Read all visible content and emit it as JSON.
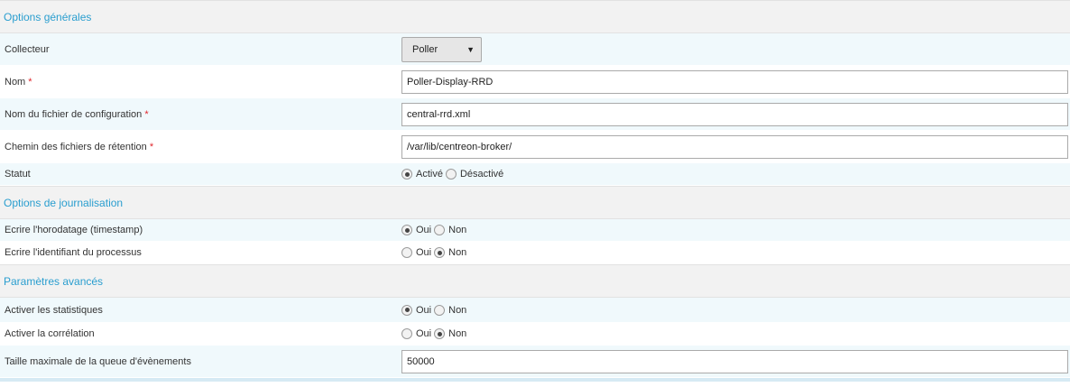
{
  "sections": {
    "general": {
      "title": "Options générales",
      "poller": {
        "label": "Collecteur",
        "value": "Poller"
      },
      "name": {
        "label": "Nom",
        "required": "*",
        "value": "Poller-Display-RRD"
      },
      "config_file": {
        "label": "Nom du fichier de configuration",
        "required": "*",
        "value": "central-rrd.xml"
      },
      "retention_path": {
        "label": "Chemin des fichiers de rétention",
        "required": "*",
        "value": "/var/lib/centreon-broker/"
      },
      "status": {
        "label": "Statut",
        "option_on": "Activé",
        "option_off": "Désactivé",
        "selected": "Activé"
      }
    },
    "logging": {
      "title": "Options de journalisation",
      "timestamp": {
        "label": "Ecrire l'horodatage (timestamp)",
        "yes": "Oui",
        "no": "Non",
        "selected": "Oui"
      },
      "thread_id": {
        "label": "Ecrire l'identifiant du processus",
        "yes": "Oui",
        "no": "Non",
        "selected": "Non"
      }
    },
    "advanced": {
      "title": "Paramètres avancés",
      "stats": {
        "label": "Activer les statistiques",
        "yes": "Oui",
        "no": "Non",
        "selected": "Oui"
      },
      "correlation": {
        "label": "Activer la corrélation",
        "yes": "Oui",
        "no": "Non",
        "selected": "Non"
      },
      "queue_size": {
        "label": "Taille maximale de la queue d'évènements",
        "value": "50000"
      }
    }
  },
  "colors": {
    "section_title": "#2a9ecf",
    "required_star": "#e0262b",
    "alt_row": "#f0f9fc",
    "header_bg": "#f2f2f2"
  }
}
